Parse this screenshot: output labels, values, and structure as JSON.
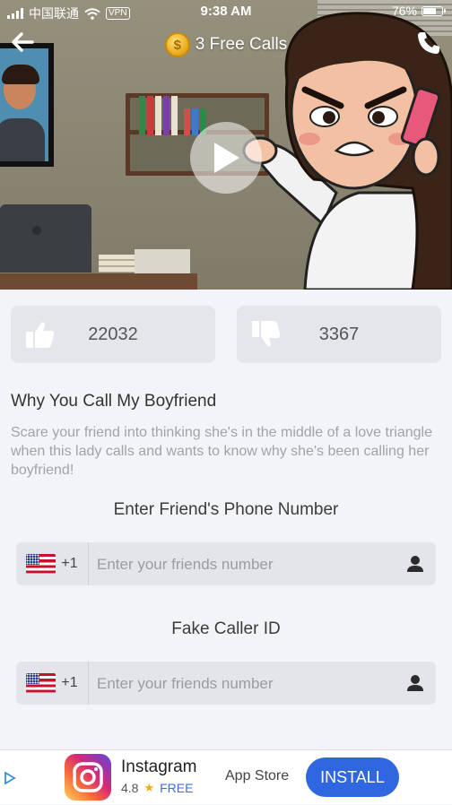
{
  "status_bar": {
    "carrier": "中国联通",
    "vpn": "VPN",
    "time": "9:38 AM",
    "battery_percent": "76%",
    "battery_level": 0.76
  },
  "header": {
    "free_calls": "3 Free Calls",
    "coin_symbol": "$"
  },
  "votes": {
    "likes": "22032",
    "dislikes": "3367"
  },
  "prank": {
    "title": "Why You Call My Boyfriend",
    "description": "Scare your friend into thinking she's in the middle of a love triangle when this lady calls and wants to know why she's been calling her boyfriend!"
  },
  "friend_phone": {
    "label": "Enter Friend's Phone Number",
    "country_code": "+1",
    "placeholder": "Enter your friends number",
    "value": ""
  },
  "caller_id": {
    "label": "Fake Caller ID",
    "country_code": "+1",
    "placeholder": "Enter your friends number",
    "value": ""
  },
  "ad": {
    "app_name": "Instagram",
    "rating": "4.8",
    "star": "★",
    "price": "FREE",
    "store": "App Store",
    "cta": "INSTALL"
  },
  "colors": {
    "accent_blue": "#2f67e0",
    "coin": "#e8a614",
    "button_bg": "#e4e6eb"
  }
}
